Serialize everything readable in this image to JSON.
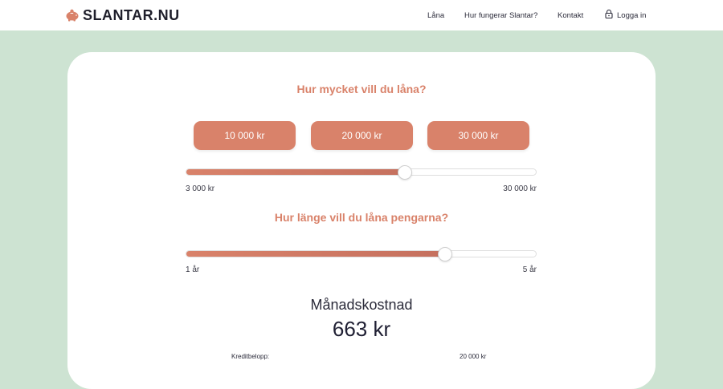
{
  "header": {
    "logo_text": "SLANTAR.NU",
    "nav": {
      "lana": "Låna",
      "how": "Hur fungerar Slantar?",
      "contact": "Kontakt",
      "login": "Logga in"
    }
  },
  "calculator": {
    "amount_question": "Hur mycket vill du låna?",
    "amount_buttons": [
      "10 000 kr",
      "20 000 kr",
      "30 000 kr"
    ],
    "amount_slider": {
      "min_label": "3 000 kr",
      "max_label": "30 000 kr",
      "value_fraction": 0.625
    },
    "duration_question": "Hur länge vill du låna pengarna?",
    "duration_slider": {
      "min_label": "1 år",
      "max_label": "5 år",
      "value_fraction": 0.74
    },
    "cost_title": "Månadskostnad",
    "cost_value": "663 kr",
    "details": [
      {
        "label": "Kreditbelopp:",
        "value": "20 000 kr"
      }
    ]
  },
  "colors": {
    "accent": "#d9826a",
    "background": "#cde3d2",
    "card": "#ffffff"
  },
  "icons": {
    "logo": "piggy-bank-icon",
    "login": "lock-icon"
  }
}
